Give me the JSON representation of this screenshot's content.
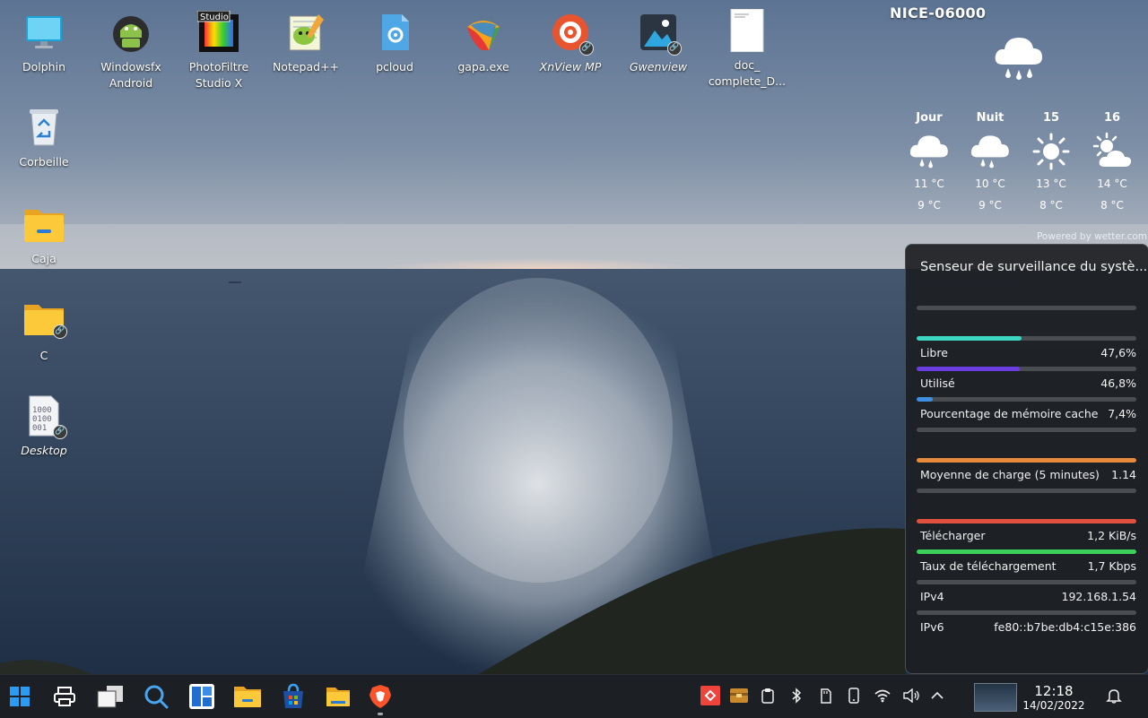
{
  "desktop": {
    "icons": [
      {
        "label": "Dolphin",
        "name": "dolphin-icon"
      },
      {
        "label": "Windowsfx\nAndroid",
        "name": "android-icon"
      },
      {
        "label": "PhotoFiltre\nStudio X",
        "name": "photofiltre-icon",
        "badge": "Studio"
      },
      {
        "label": "Notepad++",
        "name": "notepadpp-icon"
      },
      {
        "label": "pcloud",
        "name": "pcloud-icon"
      },
      {
        "label": "gapa.exe",
        "name": "gapa-icon"
      },
      {
        "label": "XnView MP",
        "name": "xnview-icon"
      },
      {
        "label": "Gwenview",
        "name": "gwenview-icon"
      },
      {
        "label": "doc_\ncomplete_D...",
        "name": "document-icon"
      },
      {
        "label": "Corbeille",
        "name": "recycle-bin-icon"
      },
      {
        "label": "Caja",
        "name": "folder-icon"
      },
      {
        "label": "C",
        "name": "folder-link-icon"
      },
      {
        "label": "Desktop",
        "name": "binary-file-icon"
      }
    ]
  },
  "weather": {
    "city": "NICE-06000",
    "current_icon": "rain-cloud-icon",
    "forecast": [
      {
        "day": "Jour",
        "icon": "rain-cloud-icon",
        "high": "11 °C",
        "low": "9 °C"
      },
      {
        "day": "Nuit",
        "icon": "rain-cloud-icon",
        "high": "10 °C",
        "low": "9 °C"
      },
      {
        "day": "15",
        "icon": "sun-icon",
        "high": "13 °C",
        "low": "8 °C"
      },
      {
        "day": "16",
        "icon": "sun-cloud-icon",
        "high": "14 °C",
        "low": "8 °C"
      }
    ],
    "powered_by": "Powered by wetter.com"
  },
  "sensor": {
    "title": "Senseur de surveillance du systè...",
    "rows": [
      {
        "label": "",
        "value": "",
        "percent": 0,
        "color": "#4a4d52"
      },
      {
        "label": "Libre",
        "value": "47,6%",
        "percent": 47.6,
        "color": "#3dd6c4"
      },
      {
        "label": "Utilisé",
        "value": "46,8%",
        "percent": 46.8,
        "color": "#6a3de0"
      },
      {
        "label": "Pourcentage de mémoire cache",
        "value": "7,4%",
        "percent": 7.4,
        "color": "#3d8fe0"
      },
      {
        "label": "",
        "value": "",
        "percent": 0,
        "color": "#4a4d52"
      },
      {
        "label": "Moyenne de charge (5 minutes)",
        "value": "1.14",
        "percent": 100,
        "color": "#e88a3c"
      },
      {
        "label": "",
        "value": "",
        "percent": 0,
        "color": "#4a4d52"
      },
      {
        "label": "Télécharger",
        "value": "1,2 KiB/s",
        "percent": 100,
        "color": "#e0503c"
      },
      {
        "label": "Taux de téléchargement",
        "value": "1,7 Kbps",
        "percent": 100,
        "color": "#3ccf5a"
      },
      {
        "label": "IPv4",
        "value": "192.168.1.54",
        "percent": 0,
        "color": "#4a4d52"
      },
      {
        "label": "IPv6",
        "value": "fe80::b7be:db4:c15e:386",
        "percent": 0,
        "color": "#4a4d52"
      }
    ]
  },
  "taskbar": {
    "apps": [
      {
        "name": "start-button",
        "icon": "windows-logo-icon"
      },
      {
        "name": "printer-button",
        "icon": "printer-icon"
      },
      {
        "name": "show-desktop-button",
        "icon": "window-stack-icon"
      },
      {
        "name": "search-button",
        "icon": "search-icon"
      },
      {
        "name": "widgets-button",
        "icon": "widgets-icon"
      },
      {
        "name": "file-explorer-button",
        "icon": "folder-icon"
      },
      {
        "name": "store-button",
        "icon": "store-bag-icon"
      },
      {
        "name": "files-button",
        "icon": "folder-icon"
      },
      {
        "name": "brave-button",
        "icon": "brave-lion-icon"
      }
    ],
    "tray": [
      "anydesk-icon",
      "archive-icon",
      "clipboard-icon",
      "bluetooth-icon",
      "sd-card-icon",
      "phone-icon",
      "wifi-icon",
      "volume-icon",
      "chevron-up-icon"
    ],
    "time": "12:18",
    "date": "14/02/2022"
  }
}
